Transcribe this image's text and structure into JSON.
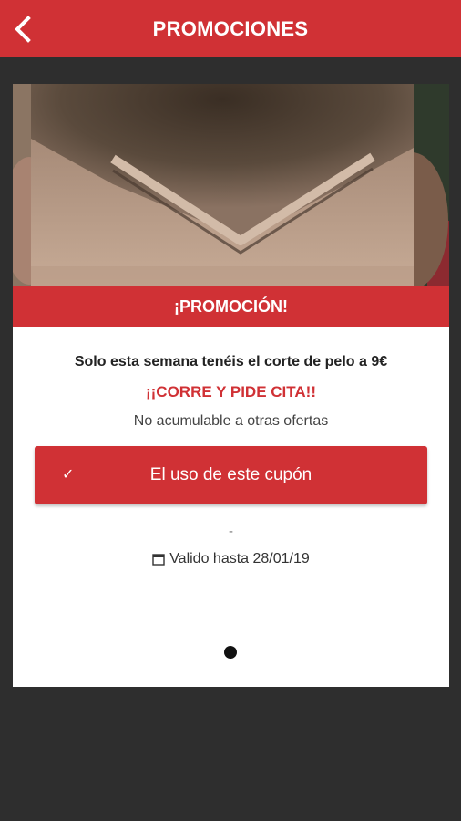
{
  "appbar": {
    "title": "PROMOCIONES",
    "back_icon": "chevron-left-icon",
    "color": "#d03135"
  },
  "promotion": {
    "image": "back-of-head-haircut-photo",
    "banner": "¡PROMOCIÓN!",
    "description": "Solo esta semana tenéis el corte de pelo a 9€",
    "cta": "¡¡CORRE Y PIDE CITA!!",
    "note": "No acumulable a otras ofertas",
    "coupon_button": {
      "icon": "check-icon",
      "check_glyph": "✓",
      "label": "El uso de este cupón"
    },
    "separator": "-",
    "validity": {
      "icon": "calendar-icon",
      "text": "Valido hasta 28/01/19"
    }
  },
  "pager": {
    "current": 1,
    "total": 1
  },
  "colors": {
    "accent": "#d03135",
    "background": "#2e2e2e",
    "card": "#ffffff"
  }
}
